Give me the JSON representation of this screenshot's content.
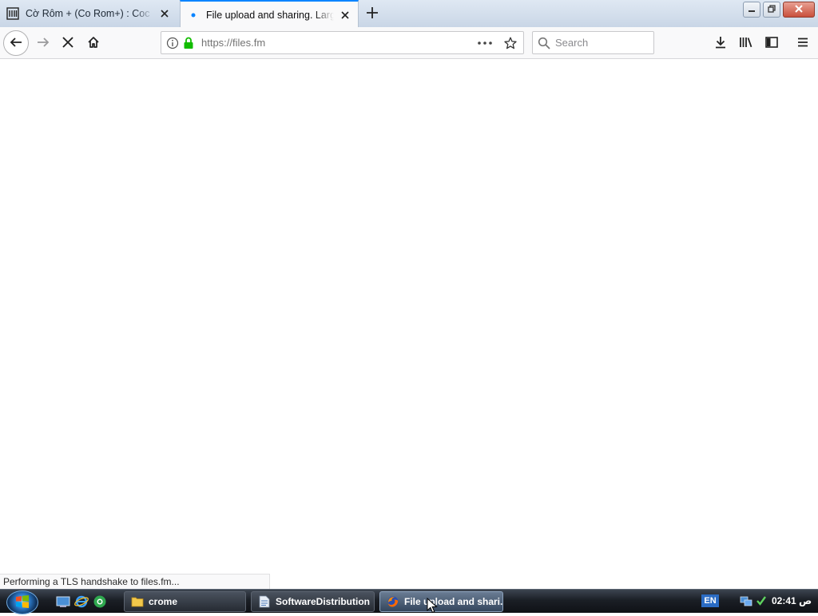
{
  "browser": {
    "tabs": [
      {
        "title": "Cờ Rôm + (Co Rom+) : Coc Coc",
        "icon": "library-icon",
        "active": false
      },
      {
        "title": "File upload and sharing. Large files",
        "icon": "loading-dot-icon",
        "active": true
      }
    ],
    "new_tab_icon": "plus-icon",
    "window_controls": [
      "minimize-icon",
      "restore-icon",
      "close-icon"
    ],
    "nav": {
      "url": "https://files.fm",
      "search_placeholder": "Search"
    },
    "status_text": "Performing a TLS handshake to files.fm..."
  },
  "taskbar": {
    "windows": [
      {
        "label": "crome",
        "icon": "folder-icon",
        "active": false
      },
      {
        "label": "SoftwareDistribution",
        "icon": "document-icon",
        "active": false
      },
      {
        "label": "File upload and shari...",
        "icon": "firefox-icon",
        "active": true
      }
    ],
    "language": "EN",
    "clock": "02:41 ص"
  },
  "colors": {
    "accent": "#0a84ff",
    "lock_green": "#12bc00",
    "taskbar": "#1b1f26"
  }
}
